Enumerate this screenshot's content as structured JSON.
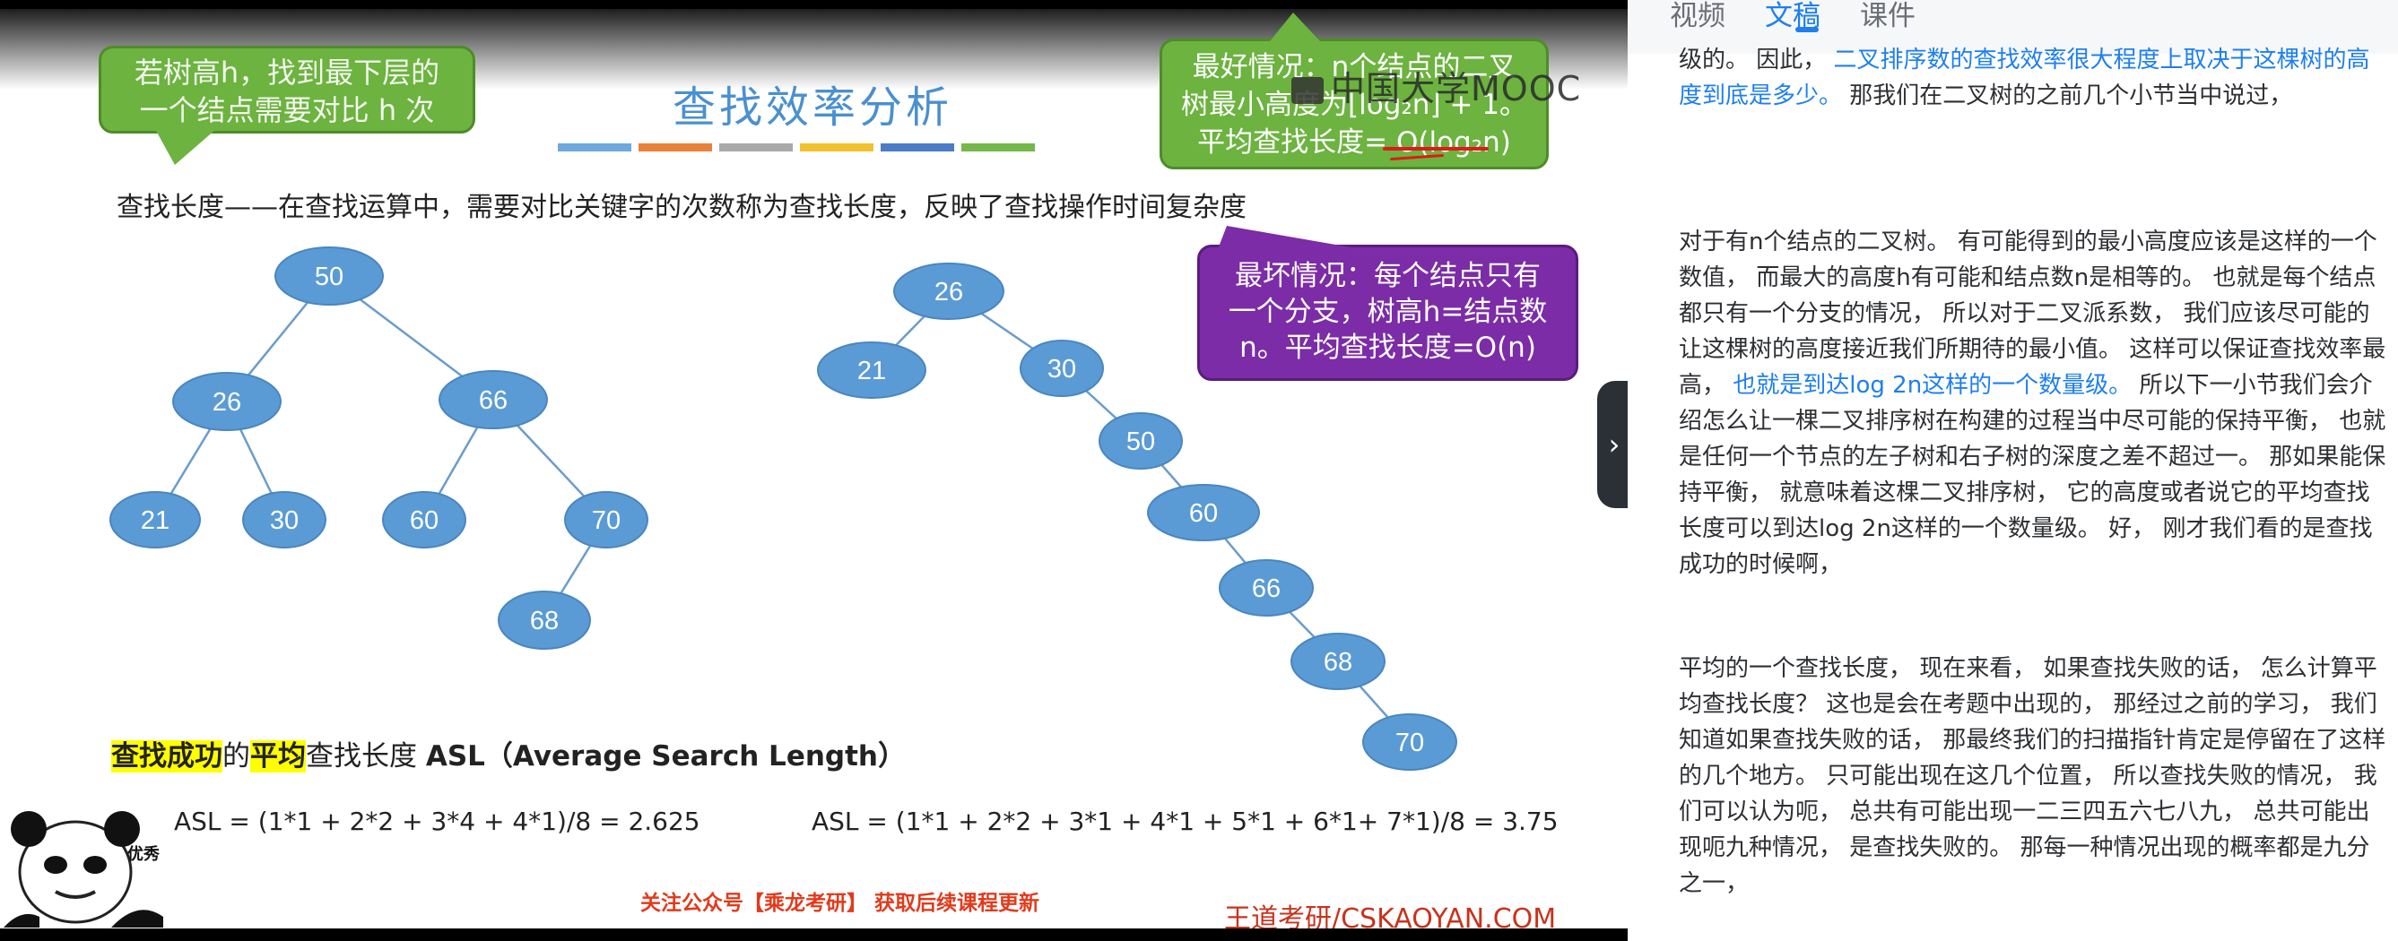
{
  "slide": {
    "title": "查找效率分析",
    "colors": [
      "#6fa8dc",
      "#e8823a",
      "#a9a9a9",
      "#f2c12e",
      "#4a7cc9",
      "#74b84a"
    ],
    "callout_left": [
      "若树高h，找到最下层的",
      "一个结点需要对比 h 次"
    ],
    "callout_best": [
      "最好情况：n个结点的二叉",
      "树最小高度为⌊log₂n⌋ + 1。",
      "平均查找长度= O(log₂n)"
    ],
    "callout_worst": [
      "最坏情况：每个结点只有",
      "一个分支，树高h=结点数",
      "n。平均查找长度=O(n)"
    ],
    "watermark": "中国大学MOOC",
    "definition": "查找长度——在查找运算中，需要对比关键字的次数称为查找长度，反映了查找操作时间复杂度",
    "tree_balanced": [
      "50",
      "26",
      "66",
      "21",
      "30",
      "60",
      "70",
      "68"
    ],
    "tree_skewed": [
      "26",
      "21",
      "30",
      "50",
      "60",
      "66",
      "68",
      "70"
    ],
    "asl_heading": {
      "part1": "查找成功",
      "part2": "的",
      "part3": "平均",
      "part4": "查找长度 ",
      "part5": "ASL（Average Search Length）"
    },
    "formula_1": "ASL = (1*1 + 2*2 + 3*4 + 4*1)/8 = 2.625",
    "formula_2": "ASL = (1*1 + 2*2 + 3*1 + 4*1 + 5*1 + 6*1+  7*1)/8 = 3.75",
    "meme_text": "优秀",
    "notice": "关注公众号【乘龙考研】 获取后续课程更新",
    "brand": "王道考研/CSKAOYAN.COM"
  },
  "expand_icon": "chevron-right-icon",
  "panel": {
    "tabs": [
      "视频",
      "文稿",
      "课件"
    ],
    "active_tab": "文稿",
    "paragraphs": {
      "p0_a": "级的。 因此， ",
      "p0_b": "二叉排序数的查找效率很大程度上取决于这棵树的高度到底是多少。",
      "p0_c": " 那我们在二叉树的之前几个小节当中说过，",
      "p1_a": "对于有n个结点的二叉树。 有可能得到的最小高度应该是这样的一个数值， 而最大的高度h有可能和结点数n是相等的。 也就是每个结点都只有一个分支的情况， 所以对于二叉派系数， 我们应该尽可能的让这棵树的高度接近我们所期待的最小值。 这样可以保证查找效率最高， ",
      "p1_b": "也就是到达log 2n这样的一个数量级。",
      "p1_c": " 所以下一小节我们会介绍怎么让一棵二叉排序树在构建的过程当中尽可能的保持平衡， 也就是任何一个节点的左子树和右子树的深度之差不超过一。 那如果能保持平衡， 就意味着这棵二叉排序树， 它的高度或者说它的平均查找长度可以到达log 2n这样的一个数量级。 好， 刚才我们看的是查找成功的时候啊，",
      "p2": "平均的一个查找长度， 现在来看， 如果查找失败的话， 怎么计算平均查找长度？ 这也是会在考题中出现的， 那经过之前的学习， 我们知道如果查找失败的话， 那最终我们的扫描指针肯定是停留在了这样的几个地方。 只可能出现在这几个位置， 所以查找失败的情况， 我们可以认为呃， 总共有可能出现一二三四五六七八九， 总共可能出现呃九种情况， 是查找失败的。 那每一种情况出现的概率都是九分之一，"
    }
  }
}
